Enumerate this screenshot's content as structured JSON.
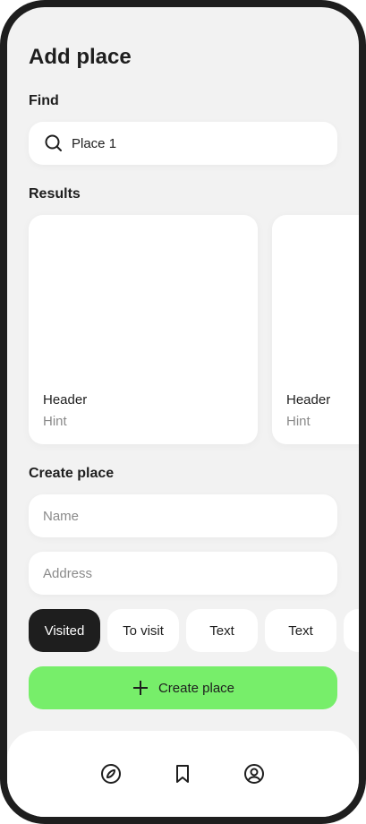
{
  "header": {
    "title": "Add place"
  },
  "find": {
    "label": "Find",
    "search_value": "Place 1",
    "icon": "search-icon"
  },
  "results": {
    "label": "Results",
    "cards": [
      {
        "header": "Header",
        "hint": "Hint"
      },
      {
        "header": "Header",
        "hint": "Hint"
      }
    ]
  },
  "create": {
    "label": "Create place",
    "name_placeholder": "Name",
    "address_placeholder": "Address",
    "chips": [
      {
        "label": "Visited",
        "active": true
      },
      {
        "label": "To visit"
      },
      {
        "label": "Text"
      },
      {
        "label": "Text"
      }
    ],
    "button_label": "Create place",
    "accent": "#77EE6A"
  },
  "nav": {
    "items": [
      "compass-icon",
      "bookmark-icon",
      "profile-icon"
    ]
  }
}
